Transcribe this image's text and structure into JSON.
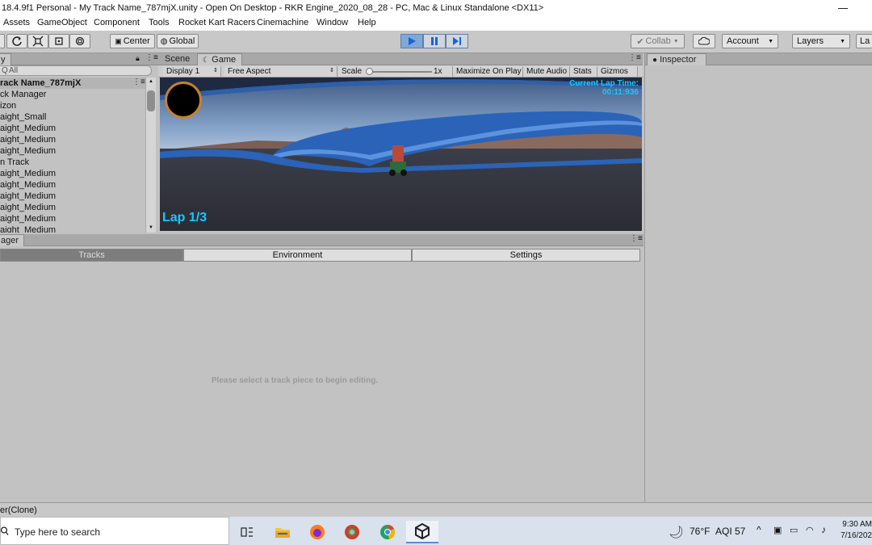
{
  "window": {
    "title": "18.4.9f1 Personal - My Track Name_787mjX.unity - Open On Desktop - RKR Engine_2020_08_28 - PC, Mac & Linux Standalone <DX11>"
  },
  "menubar": {
    "items": [
      "Assets",
      "GameObject",
      "Component",
      "Tools",
      "Rocket Kart Racers",
      "Cinemachine",
      "Window",
      "Help"
    ]
  },
  "toolbar": {
    "center_label": "Center",
    "global_label": "Global",
    "collab_label": "Collab",
    "account_label": "Account",
    "layers_label": "Layers",
    "layout_label": "La"
  },
  "hierarchy": {
    "tab_label": "y",
    "search_placeholder": "All",
    "root": "rack Name_787mjX",
    "items": [
      "ck Manager",
      "izon",
      "aight_Small",
      "aight_Medium",
      "aight_Medium",
      "aight_Medium",
      "n Track",
      "aight_Medium",
      "aight_Medium",
      "aight_Medium",
      "aight_Medium",
      "aight_Medium",
      "aight_Medium"
    ]
  },
  "view_tabs": {
    "scene": "Scene",
    "game": "Game"
  },
  "game_toolbar": {
    "display": "Display 1",
    "aspect": "Free Aspect",
    "scale_label": "Scale",
    "scale_value": "1x",
    "maximize": "Maximize On Play",
    "mute": "Mute Audio",
    "stats": "Stats",
    "gizmos": "Gizmos"
  },
  "game_hud": {
    "current_lap_label": "Current Lap Time:",
    "current_lap_time": "00:11:936",
    "lap": "Lap 1/3"
  },
  "inspector": {
    "tab_label": "Inspector"
  },
  "track_manager": {
    "tab_label": "ager",
    "tabs": [
      "Tracks",
      "Environment",
      "Settings"
    ],
    "message": "Please select a track piece to begin editing."
  },
  "status_bar": {
    "text": "er(Clone)"
  },
  "taskbar": {
    "search_placeholder": "Type here to search",
    "weather": "76°F",
    "aqi": "AQI 57",
    "time": "9:30 AM",
    "date": "7/16/202"
  },
  "colors": {
    "accent_play": "#7fa7d8",
    "hud_cyan": "#19c7ff",
    "panel_bg": "#c2c2c2",
    "taskbar_bg": "#d9e1ec"
  }
}
